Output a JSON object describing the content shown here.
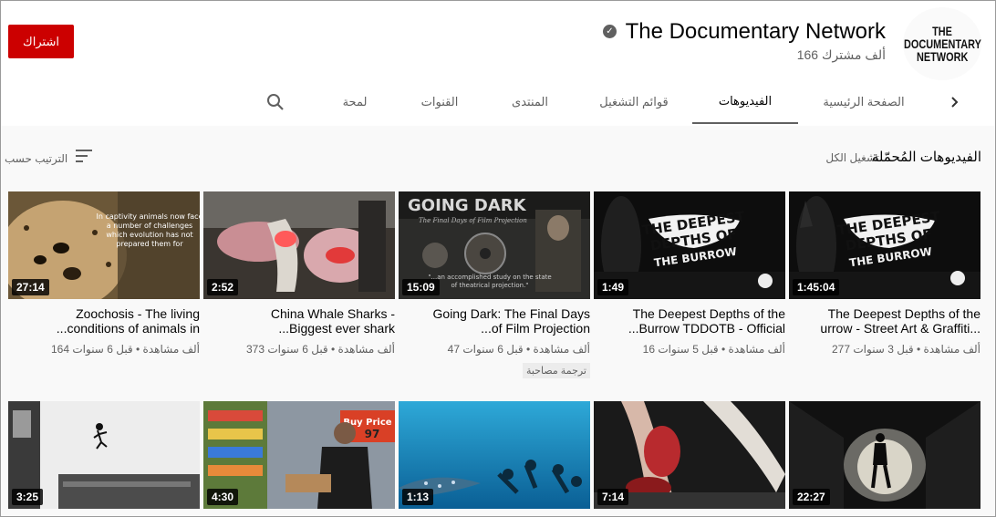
{
  "header": {
    "channel_name": "The Documentary Network",
    "subscriber_count": "166 ألف مشترك",
    "subscribe_label": "اشتراك",
    "avatar_lines": [
      "THE",
      "DOCUMENTARY",
      "NETWORK"
    ]
  },
  "tabs": [
    {
      "label": "الصفحة الرئيسية",
      "active": false
    },
    {
      "label": "الفيديوهات",
      "active": true
    },
    {
      "label": "قوائم التشغيل",
      "active": false
    },
    {
      "label": "المنتدى",
      "active": false
    },
    {
      "label": "القنوات",
      "active": false
    },
    {
      "label": "لمحة",
      "active": false
    }
  ],
  "section": {
    "title": "الفيديوهات المُحمّلة",
    "play_all": "تشغيل الكل",
    "sort_label": "الترتيب حسب"
  },
  "videos": [
    {
      "title_line1": "The Deepest Depths of the",
      "title_line2": "urrow - Street Art & Graffiti...",
      "meta": "277 ألف مشاهدة • قبل 3 سنوات",
      "duration": "1:45:04",
      "thumb_text": "THE DEEPEST DEPTHS OF THE BURROW"
    },
    {
      "title_line1": "The Deepest Depths of the",
      "title_line2": "...Burrow TDDOTB - Official",
      "meta": "16 ألف مشاهدة • قبل 5 سنوات",
      "duration": "1:49",
      "thumb_text": "THE DEEPEST DEPTHS OF THE BURROW"
    },
    {
      "title_line1": "Going Dark: The Final Days",
      "title_line2": "...of Film Projection",
      "meta": "47 ألف مشاهدة • قبل 6 سنوات",
      "duration": "15:09",
      "badge": "ترجمة مصاحبة",
      "thumb_text": "GOING DARK",
      "thumb_sub": "The Final Days of Film Projection"
    },
    {
      "title_line1": "China Whale Sharks -",
      "title_line2": "...Biggest ever shark",
      "meta": "373 ألف مشاهدة • قبل 6 سنوات",
      "duration": "2:52"
    },
    {
      "title_line1": "Zoochosis - The living",
      "title_line2": "...conditions of animals in",
      "meta": "164 ألف مشاهدة • قبل 6 سنوات",
      "duration": "27:14",
      "thumb_text": "In captivity animals now face a number of challenges which evolution has not prepared them for"
    },
    {
      "duration": "22:27"
    },
    {
      "duration": "7:14"
    },
    {
      "duration": "1:13"
    },
    {
      "duration": "4:30",
      "thumb_text": "Buy Price 97"
    },
    {
      "duration": "3:25"
    }
  ],
  "colors": {
    "subscribe_red": "#cc0000",
    "page_bg": "#f9f9f9",
    "header_bg": "#ffffff",
    "secondary_text": "#606060"
  },
  "icons": [
    "verified-check-icon",
    "search-icon",
    "chevron-right-icon",
    "sort-icon"
  ]
}
